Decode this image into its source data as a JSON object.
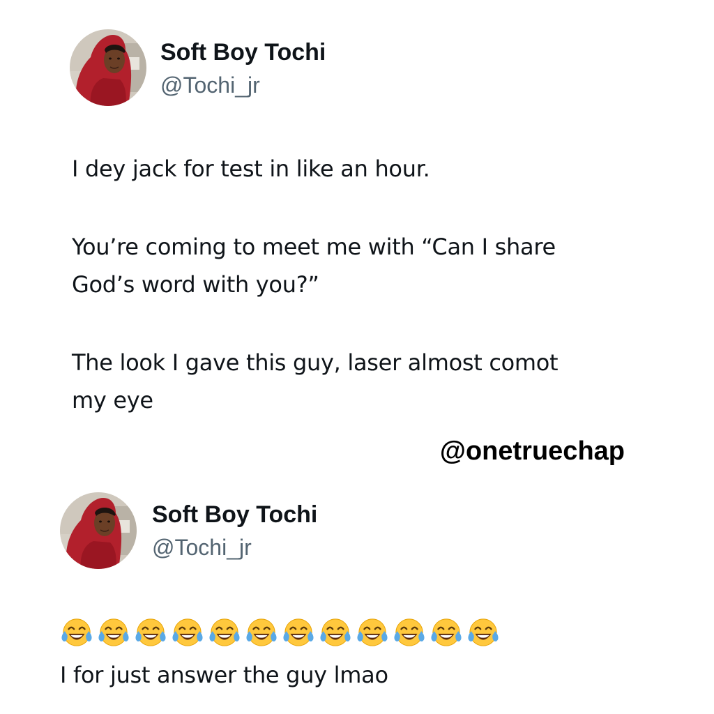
{
  "tweets": [
    {
      "display_name": "Soft Boy Tochi",
      "handle": "@Tochi_jr",
      "avatar_icon": "profile-photo-avatar",
      "body_lines": [
        "I dey jack for test in like an hour.",
        "You’re coming to meet me with “Can I share",
        "God’s word with you?”",
        "The look I gave this guy, laser almost comot",
        "my eye"
      ]
    },
    {
      "display_name": "Soft Boy Tochi",
      "handle": "@Tochi_jr",
      "avatar_icon": "profile-photo-avatar",
      "emoji_icon": "face-with-tears-of-joy-emoji",
      "emoji_count": 12,
      "body_lines": [
        "I for just answer the guy lmao"
      ]
    }
  ],
  "watermark": "@onetruechap",
  "colors": {
    "text": "#0f1419",
    "handle": "#536471",
    "background": "#ffffff",
    "emoji_yellow": "#ffc83d",
    "emoji_tears": "#5aa9e6"
  }
}
